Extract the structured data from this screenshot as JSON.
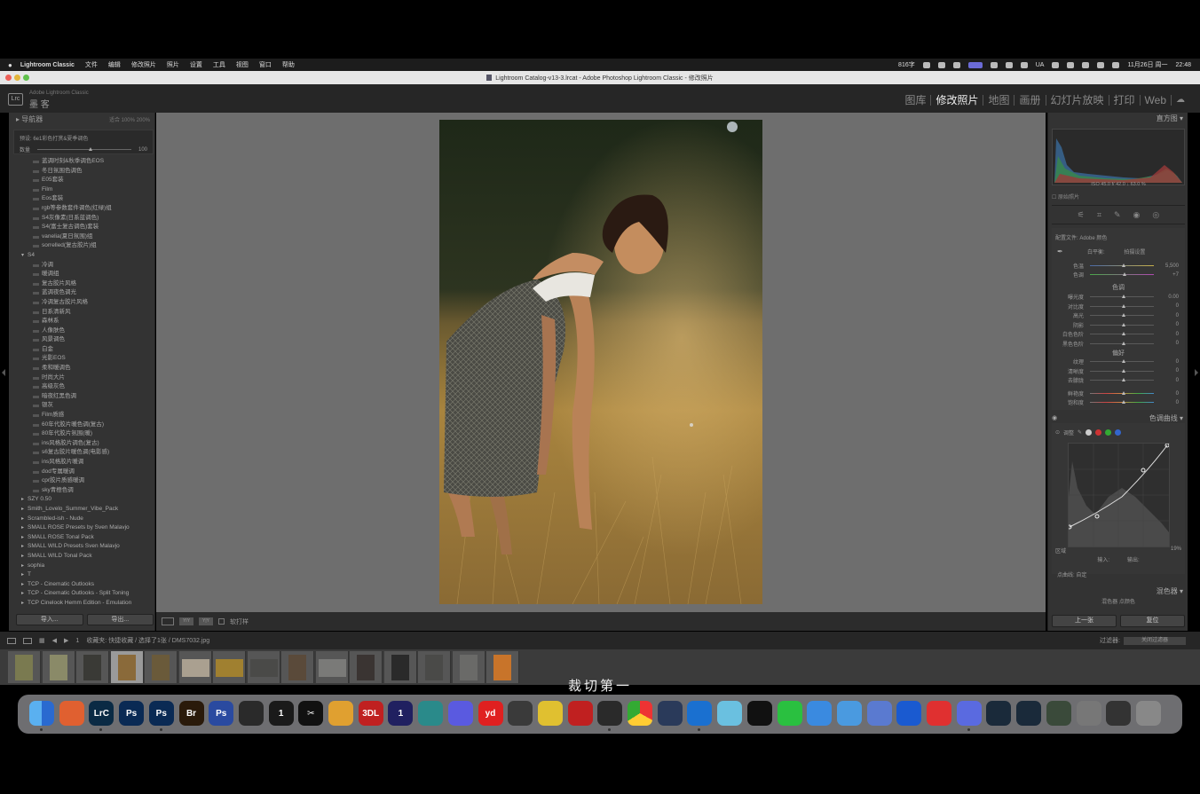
{
  "menubar": {
    "app": "Lightroom Classic",
    "items": [
      "文件",
      "编辑",
      "修改照片",
      "照片",
      "设置",
      "工具",
      "视图",
      "窗口",
      "帮助"
    ],
    "right_text": "816字",
    "date": "11月26日 周一",
    "time": "22:48",
    "input_badge": "UA"
  },
  "window": {
    "title": "Lightroom Catalog-v13-3.lrcat - Adobe Photoshop Lightroom Classic - 修改照片"
  },
  "lr_header": {
    "logo": "Lrc",
    "brand_small": "Adobe Lightroom Classic",
    "brand_name": "墨 客",
    "modules": [
      "图库",
      "修改照片",
      "地图",
      "画册",
      "幻灯片放映",
      "打印",
      "Web"
    ],
    "active_module": "修改照片"
  },
  "left_panel": {
    "navigator_label": "导航器",
    "navigator_zoom": "适合  100%  200%",
    "preset_title": "预设: 6e1彩色打赏&夏季调色",
    "amount_label": "数量",
    "amount_value": "100",
    "amount_fraction": 0.55,
    "presets_top": [
      "蓝调时刻&秋季调色EOS",
      "冬日氛围色调色",
      "E05套装",
      "Film",
      "Eos套装",
      "rgb等参数套件调色(红绿)组",
      "S4灰像素(日系蓝调色)",
      "S4(富士复古调色)套装",
      "vanelia(夏日氛围)组",
      "sorrelled(复古胶片)组"
    ],
    "group_open": "S4",
    "presets_s4": [
      "冷调",
      "暖调组",
      "复古胶片风格",
      "蓝调夜色调光",
      "冷调复古胶片风格",
      "日系清新风",
      "森林系",
      "人像肤色",
      "风景调色",
      "白金",
      "光影EOS",
      "柔和暖调色",
      "时尚大片",
      "高级灰色",
      "暗夜红黑色调",
      "银灰",
      "Film质感",
      "60年代胶片暖色调(复古)",
      "80年代胶片氛围(暖)",
      "ins风格胶片调色(复古)",
      "s6复古胶片暖色调(电影感)",
      "ins风格胶片暖调",
      "dod专属暖调",
      "cpr胶片质感暖调",
      "sky青橙色调"
    ],
    "groups_bottom": [
      "SZY 0.50",
      "Smith_Lovelo_Summer_Vibe_Pack",
      "Scrambled-ish - Nude",
      "SMALL ROSE Presets by Sven Malavjo",
      "SMALL ROSE Tonal Pack",
      "SMALL WILD Presets Sven Malavjo",
      "SMALL WILD Tonal Pack",
      "sophia",
      "T",
      "TCP - Cinematic Outlooks",
      "TCP - Cinematic Outlooks - Split Toning",
      "TCP Cinelook Hemm Edition - Emulation"
    ],
    "btn_import": "导入...",
    "btn_export": "导出..."
  },
  "center": {
    "toolbar_softproof": "软打样"
  },
  "right_panel": {
    "histogram_label": "直方图",
    "histo_values": "ISO  45.0  f/  42.0  ↓  63.0 %",
    "original_photo": "原始照片",
    "profile_label": "配置文件:",
    "profile_value": "Adobe 颜色",
    "wb_label": "白平衡:",
    "wb_value": "拍摄设置",
    "temp_label": "色温",
    "temp_value": "5,500",
    "tint_label": "色调",
    "tint_value": "+7",
    "tone_header": "色调",
    "tone_sliders": [
      {
        "label": "曝光度",
        "value": "0.00",
        "pos": 0.5
      },
      {
        "label": "对比度",
        "value": "0",
        "pos": 0.5
      },
      {
        "label": "高光",
        "value": "0",
        "pos": 0.5
      },
      {
        "label": "阴影",
        "value": "0",
        "pos": 0.5
      },
      {
        "label": "白色色阶",
        "value": "0",
        "pos": 0.5
      },
      {
        "label": "黑色色阶",
        "value": "0",
        "pos": 0.5
      }
    ],
    "presence_header": "偏好",
    "presence_sliders": [
      {
        "label": "纹理",
        "value": "0",
        "pos": 0.5
      },
      {
        "label": "清晰度",
        "value": "0",
        "pos": 0.5
      },
      {
        "label": "去朦胧",
        "value": "0",
        "pos": 0.5
      }
    ],
    "color_sliders": [
      {
        "label": "鲜艳度",
        "value": "0",
        "pos": 0.5
      },
      {
        "label": "饱和度",
        "value": "0",
        "pos": 0.5
      }
    ],
    "curve_header": "色调曲线",
    "curve_adjust": "调整",
    "curve_region": "区域",
    "curve_input": "输入:",
    "curve_output": "输出:",
    "curve_channel": "点曲线: 自定",
    "curve_value": "19%",
    "next_header": "混色器",
    "hsl_tabs": "混色器  点颜色",
    "btn_prev": "上一张",
    "btn_reset": "复位"
  },
  "filmstrip": {
    "page_label": "1",
    "source": "收藏夹: 快捷收藏 / 选择了1张 / DMS7032.jpg",
    "filter_label": "过滤器:",
    "filter_value": "关闭过滤器",
    "thumb_count": 15,
    "selected_index": 3
  },
  "caption": "裁切第一",
  "dock": {
    "apps": [
      "Finder",
      "Launchpad",
      "Lightroom Classic",
      "Photoshop",
      "Photoshop Beta",
      "Bridge",
      "Ps",
      "Screens",
      "1Password",
      "CapCut",
      "Keynote",
      "3DL",
      "Opera",
      "Mirror",
      "Discord",
      "Youdao",
      "Figma",
      "Notes",
      "Screen Recorder",
      "Safari Script",
      "Chrome",
      "Screen Sharing",
      "Edge",
      "Lemon",
      "QQ",
      "WeChat",
      "Baidu Net Disk",
      "Finder Face",
      "Preview",
      "Arrow",
      "NetEase Music",
      "Ducc",
      "Steam",
      "Steam Link",
      "Stats",
      "Screenshot",
      "Terminal",
      "Trash"
    ]
  }
}
